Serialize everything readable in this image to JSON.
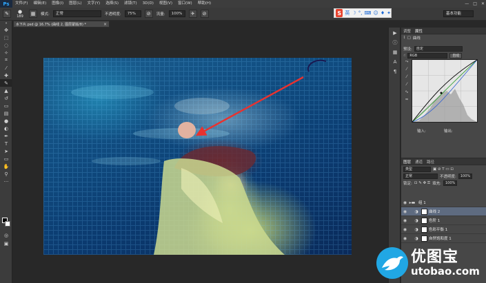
{
  "app": {
    "logo": "Ps"
  },
  "menu": [
    "文件(F)",
    "编辑(E)",
    "图像(I)",
    "图层(L)",
    "文字(Y)",
    "选择(S)",
    "滤镜(T)",
    "3D(D)",
    "视图(V)",
    "窗口(W)",
    "帮助(H)"
  ],
  "window_controls": [
    "—",
    "□",
    "✕"
  ],
  "options": {
    "brush_size": "189",
    "mode_label": "模式:",
    "mode_value": "正常",
    "opacity_label": "不透明度:",
    "opacity_value": "75%",
    "flow_label": "流量:",
    "flow_value": "100%",
    "workspace": "基本功能"
  },
  "sogou": {
    "logo": "S",
    "lang": "英"
  },
  "document_tab": {
    "title": "水下片.psd @ 16.7% (曲线 2, 图层蒙版/8) *",
    "close": "×"
  },
  "properties": {
    "tabs": [
      "调整",
      "属性"
    ],
    "title": "曲线",
    "preset_label": "预设:",
    "preset_value": "自定",
    "channel_value": "RGB",
    "auto_button": "自动",
    "input_label": "输入:",
    "output_label": "输出:"
  },
  "layers": {
    "tabs": [
      "图层",
      "通道",
      "路径"
    ],
    "kind_value": "类型",
    "blend_value": "正常",
    "opacity_label": "不透明度:",
    "opacity_value": "100%",
    "lock_label": "锁定:",
    "fill_label": "填充:",
    "fill_value": "100%",
    "items": [
      {
        "name": "组 1",
        "kind": "group"
      },
      {
        "name": "曲线 2",
        "kind": "adjust",
        "selected": true
      },
      {
        "name": "色阶 1",
        "kind": "adjust"
      },
      {
        "name": "色彩平衡 1",
        "kind": "adjust"
      },
      {
        "name": "自然饱和度 1",
        "kind": "adjust"
      }
    ]
  },
  "watermark": {
    "cn": "优图宝",
    "en": "utobao.com"
  },
  "colors": {
    "accent_arrow": "#e8322f",
    "canvas_bg": "#282828",
    "panel_bg": "#474747"
  }
}
